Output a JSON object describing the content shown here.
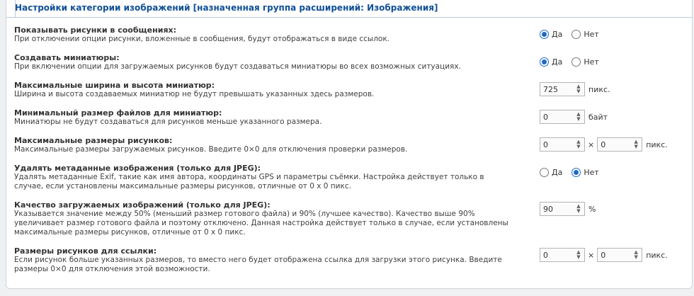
{
  "legend": "Настройки категории изображений [назначенная группа расширений: Изображения]",
  "rows": [
    {
      "title": "Показывать рисунки в сообщениях:",
      "desc": "При отключении опции рисунки, вложенные в сообщения, будут отображаться в виде ссылок.",
      "yes": "Да",
      "no": "Нет",
      "selected": "yes"
    },
    {
      "title": "Создавать миниатюры:",
      "desc": "При включении опции для загружаемых рисунков будут создаваться миниатюры во всех возможных ситуациях.",
      "yes": "Да",
      "no": "Нет",
      "selected": "yes"
    },
    {
      "title": "Максимальные ширина и высота миниатюр:",
      "desc": "Ширина и высота создаваемых миниатюр не будут превышать указанных здесь размеров.",
      "value": "725",
      "unit": "пикс."
    },
    {
      "title": "Минимальный размер файлов для миниатюр:",
      "desc": "Миниатюры не будут создаваться для рисунков меньше указанного размера.",
      "value": "0",
      "unit": "байт"
    },
    {
      "title": "Максимальные размеры рисунков:",
      "desc": "Максимальные размеры загружаемых рисунков. Введите 0×0 для отключения проверки размеров.",
      "width": "0",
      "height": "0",
      "sep": "×",
      "unit": "пикс."
    },
    {
      "title": "Удалять метаданные изображения (только для JPEG):",
      "desc": "Удалять метаданные Exif, такие как имя автора, координаты GPS и параметры съёмки. Настройка действует только в случае, если установлены максимальные размеры рисунков, отличные от 0 x 0 пикс.",
      "yes": "Да",
      "no": "Нет",
      "selected": "no"
    },
    {
      "title": "Качество загружаемых изображений (только для JPEG):",
      "desc": "Указывается значение между 50% (меньший размер готового файла) и 90% (лучшее качество). Качество выше 90% увеличивает размер готового файла и поэтому отключено. Данная настройка действует только в случае, если установлены максимальные размеры рисунков, отличные от 0 x 0 пикс.",
      "value": "90",
      "unit": "%"
    },
    {
      "title": "Размеры рисунков для ссылки:",
      "desc": "Если рисунок больше указанных размеров, то вместо него будет отображена ссылка для загрузки этого рисунка. Введите размеры 0×0 для отключения этой возможности.",
      "width": "0",
      "height": "0",
      "sep": "×",
      "unit": "пикс."
    }
  ],
  "spin_up": "▲",
  "spin_down": "▼"
}
